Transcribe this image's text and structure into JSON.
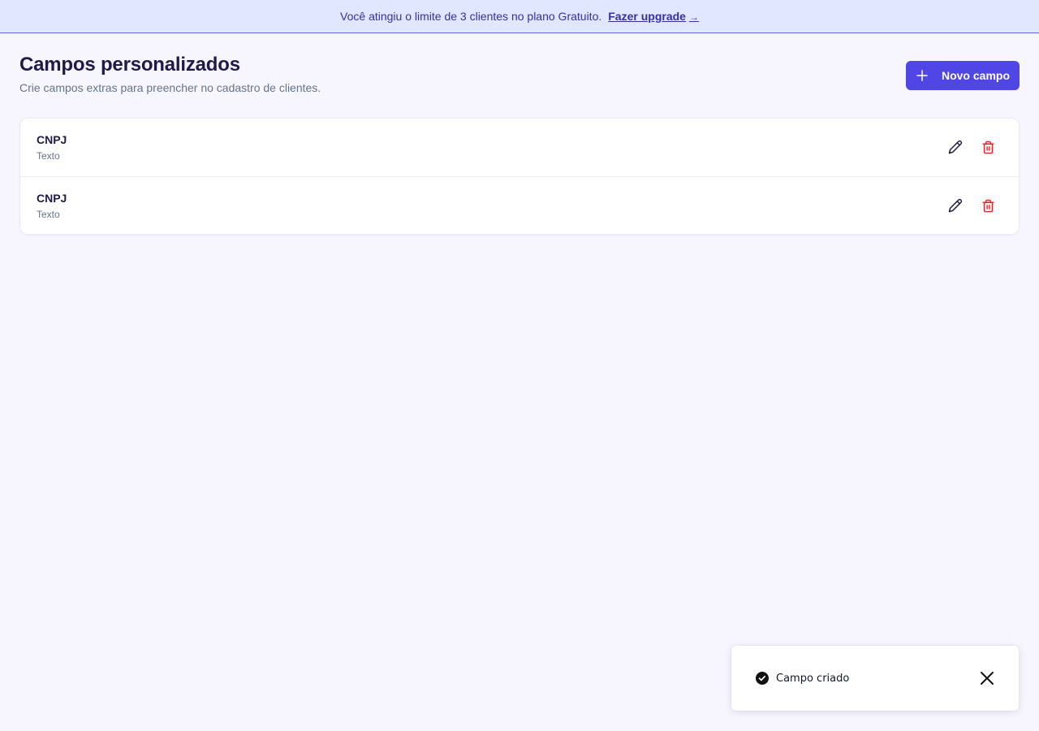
{
  "banner": {
    "message": "Você atingiu o limite de 3 clientes no plano Gratuito.",
    "link_label": "Fazer upgrade",
    "link_arrow": "→"
  },
  "header": {
    "title": "Campos personalizados",
    "subtitle": "Crie campos extras para preencher no cadastro de clientes.",
    "new_button_label": "Novo campo"
  },
  "fields": [
    {
      "name": "CNPJ",
      "type": "Texto"
    },
    {
      "name": "CNPJ",
      "type": "Texto"
    }
  ],
  "toast": {
    "message": "Campo criado"
  },
  "icons": {
    "plus": "plus-icon",
    "edit": "pencil-icon",
    "delete": "trash-icon",
    "success": "check-circle-icon",
    "close": "close-icon"
  },
  "colors": {
    "accent": "#4f46e5",
    "banner_bg": "#e0e7ff",
    "danger": "#dc2626",
    "text_dark": "#1e1b4b"
  }
}
